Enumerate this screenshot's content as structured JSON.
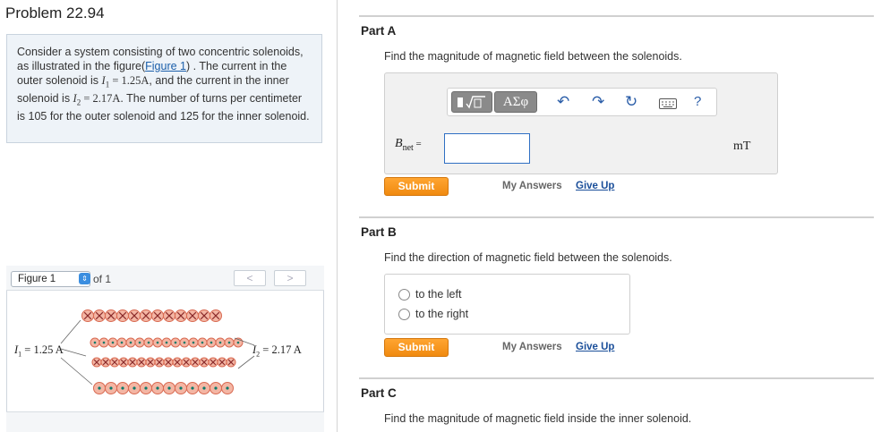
{
  "problem": {
    "title": "Problem 22.94",
    "text_1": "Consider a system consisting of two concentric solenoids, as illustrated in the figure(",
    "figure_link": "Figure 1",
    "text_2": ") . The current in the outer solenoid is ",
    "i1_symbol": "I",
    "i1_sub": "1",
    "i1_value": " = 1.25A",
    "text_3": ", and the current in the inner solenoid is ",
    "i2_symbol": "I",
    "i2_sub": "2",
    "i2_value": " = 2.17A",
    "text_4": ". The number of turns per centimeter is 105 for the outer solenoid and 125 for the inner solenoid."
  },
  "figure": {
    "select_value": "Figure 1",
    "of_label": "of 1",
    "prev_label": "<",
    "next_label": ">",
    "i1_label": "I",
    "i1_sub": "1",
    "i1_value": " = 1.25 A",
    "i2_label": "I",
    "i2_sub": "2",
    "i2_value": " = 2.17 A"
  },
  "parts": [
    {
      "title": "Part A",
      "prompt": "Find the magnitude of magnetic field between the solenoids.",
      "input_label": "B",
      "input_sub": "net",
      "input_eq": " =",
      "input_value": "",
      "unit": "mT",
      "toolbar": {
        "symbols_label": "ΑΣφ",
        "icons": [
          "templates-icon",
          "undo-icon",
          "redo-icon",
          "reset-icon",
          "keyboard-icon",
          "help-icon"
        ],
        "help_label": "?"
      },
      "submit_label": "Submit",
      "my_answers_label": "My Answers",
      "give_up_label": "Give Up"
    },
    {
      "title": "Part B",
      "prompt": "Find the direction of magnetic field between the solenoids.",
      "choices": [
        "to the left",
        "to the right"
      ],
      "submit_label": "Submit",
      "my_answers_label": "My Answers",
      "give_up_label": "Give Up"
    },
    {
      "title": "Part C",
      "prompt": "Find the magnitude of magnetic field inside the inner solenoid."
    }
  ],
  "colors": {
    "submit": "#f5940f",
    "link": "#1b4f9a",
    "problem_bg": "#eef3f8",
    "coil_fill": "#f4b6a4"
  }
}
